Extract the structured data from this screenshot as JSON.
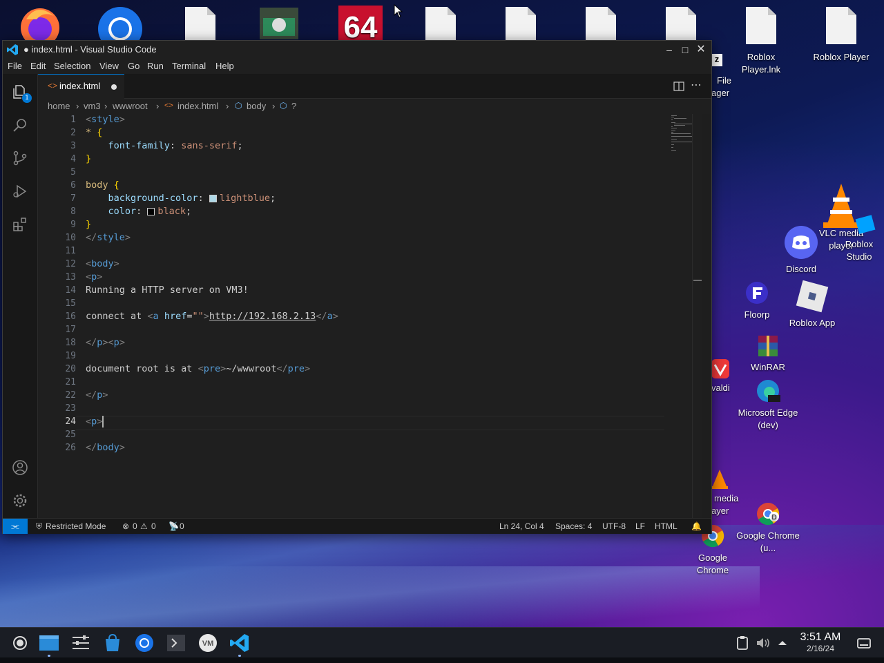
{
  "window": {
    "title": "● index.html - Visual Studio Code"
  },
  "menu": [
    "File",
    "Edit",
    "Selection",
    "View",
    "Go",
    "Run",
    "Terminal",
    "Help"
  ],
  "tab": {
    "name": "index.html"
  },
  "breadcrumb": [
    "home",
    "vm3",
    "wwwroot",
    "index.html",
    "body",
    "?"
  ],
  "explorer_badge": "1",
  "editor": {
    "current_line": 24,
    "lines": [
      {
        "n": "1"
      },
      {
        "n": "2"
      },
      {
        "n": "3"
      },
      {
        "n": "4"
      },
      {
        "n": "5"
      },
      {
        "n": "6"
      },
      {
        "n": "7"
      },
      {
        "n": "8"
      },
      {
        "n": "9"
      },
      {
        "n": "10"
      },
      {
        "n": "11"
      },
      {
        "n": "12"
      },
      {
        "n": "13"
      },
      {
        "n": "14"
      },
      {
        "n": "15"
      },
      {
        "n": "16"
      },
      {
        "n": "17"
      },
      {
        "n": "18"
      },
      {
        "n": "19"
      },
      {
        "n": "20"
      },
      {
        "n": "21"
      },
      {
        "n": "22"
      },
      {
        "n": "23"
      },
      {
        "n": "24"
      },
      {
        "n": "25"
      },
      {
        "n": "26"
      }
    ],
    "code": {
      "l1_open": "<",
      "l1_tag": "style",
      "l1_close": ">",
      "l2_sel": "*",
      "l2_brace": "{",
      "l3_prop": "font-family",
      "l3_colon": ": ",
      "l3_val": "sans-serif",
      "l3_semi": ";",
      "l4_brace": "}",
      "l6_sel": "body",
      "l6_brace": "{",
      "l7_prop": "background-color",
      "l7_colon": ": ",
      "l7_val": "lightblue",
      "l7_semi": ";",
      "l8_prop": "color",
      "l8_colon": ": ",
      "l8_val": "black",
      "l8_semi": ";",
      "l9_brace": "}",
      "l10_open": "</",
      "l10_tag": "style",
      "l10_close": ">",
      "l12_open": "<",
      "l12_tag": "body",
      "l12_close": ">",
      "l13_open": "<",
      "l13_tag": "p",
      "l13_close": ">",
      "l14_text": "Running a HTTP server on VM3!",
      "l16_text": "connect at ",
      "l16_aopen": "<",
      "l16_atag": "a",
      "l16_attr": " href",
      "l16_eq": "=",
      "l16_str": "\"\"",
      "l16_aclose": ">",
      "l16_link": "http://192.168.2.13",
      "l16_endopen": "</",
      "l16_endtag": "a",
      "l16_endclose": ">",
      "l18_a": "</",
      "l18_t1": "p",
      "l18_b": "><",
      "l18_t2": "p",
      "l18_c": ">",
      "l20_text": "document root is at ",
      "l20_open": "<",
      "l20_tag": "pre",
      "l20_close": ">",
      "l20_path": "~/wwwroot",
      "l20_eopen": "</",
      "l20_etag": "pre",
      "l20_eclose": ">",
      "l22_open": "</",
      "l22_tag": "p",
      "l22_close": ">",
      "l24_open": "<",
      "l24_tag": "p",
      "l24_close": ">",
      "l26_open": "</",
      "l26_tag": "body",
      "l26_close": ">"
    },
    "swatch_colors": {
      "lightblue": "#add8e6",
      "black": "#000000"
    }
  },
  "status": {
    "restricted": "Restricted Mode",
    "errors": "0",
    "warnings": "0",
    "ports": "0",
    "position": "Ln 24, Col 4",
    "spaces": "Spaces: 4",
    "encoding": "UTF-8",
    "eol": "LF",
    "language": "HTML"
  },
  "desktop_icons": {
    "roblox_lnk": "Roblox Player.lnk",
    "roblox_player": "Roblox Player",
    "file_manager_a": "File",
    "file_manager_b": "ager",
    "vlc": "VLC media player",
    "roblox_studio": "Roblox Studio",
    "discord": "Discord",
    "floorp": "Floorp",
    "roblox_app": "Roblox App",
    "winrar": "WinRAR",
    "vivaldi": "valdi",
    "edge_dev": "Microsoft Edge (dev)",
    "vlc2_a": "media",
    "vlc2_b": "ayer",
    "chrome": "Google Chrome",
    "chrome_u": "Google Chrome (u..."
  },
  "clock": {
    "time": "3:51 AM",
    "date": "2/16/24"
  },
  "colors": {
    "accent": "#0078d4",
    "editor_bg": "#1f1f1f"
  }
}
